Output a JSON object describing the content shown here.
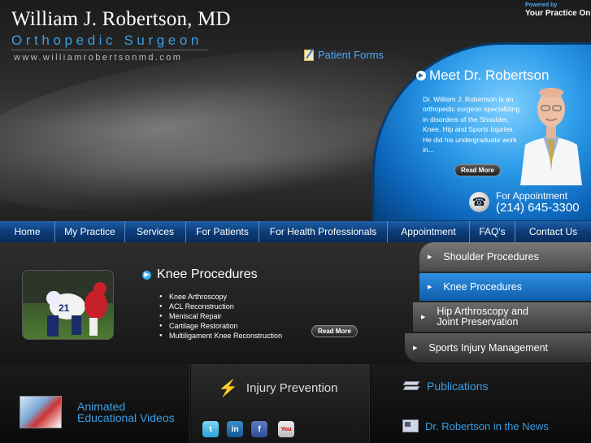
{
  "header": {
    "name": "William J. Robertson, MD",
    "title": "Orthopedic Surgeon",
    "url": "www.williamrobertsonmd.com",
    "powered_by": "Powered by",
    "powered_brand": "Your Practice Online",
    "patient_forms": "Patient Forms"
  },
  "meet": {
    "title": "Meet Dr. Robertson",
    "text": "Dr. William J. Robertson is an orthopedic surgeon specializing in disorders of the Shoulder, Knee, Hip and Sports Injuries. He did his undergraduate work in...",
    "read_more": "Read More",
    "appt_label": "For Appointment",
    "appt_phone": "(214) 645-3300"
  },
  "nav": {
    "items": [
      {
        "label": "Home"
      },
      {
        "label": "My Practice"
      },
      {
        "label": "Services"
      },
      {
        "label": "For Patients"
      },
      {
        "label": "For Health Professionals"
      },
      {
        "label": "Appointment"
      },
      {
        "label": "FAQ's"
      },
      {
        "label": "Contact Us"
      }
    ]
  },
  "knee": {
    "heading": "Knee Procedures",
    "items": [
      "Knee Arthroscopy",
      "ACL Reconstruction",
      "Meniscal Repair",
      "Cartilage Restoration",
      "Multiligament Knee Reconstruction"
    ],
    "read_more": "Read More"
  },
  "procedures": {
    "items": [
      {
        "label": "Shoulder Procedures"
      },
      {
        "label": "Knee Procedures"
      },
      {
        "label": "Hip Arthroscopy and"
      },
      {
        "label": "Joint Preservation"
      },
      {
        "label": "Sports Injury Management"
      }
    ]
  },
  "bottom": {
    "animated_line1": "Animated",
    "animated_line2": "Educational Videos",
    "injury_prevention": "Injury Prevention",
    "publications": "Publications",
    "in_the_news": "Dr. Robertson in the News"
  },
  "icons": [
    "pencil-paper-icon",
    "circle-arrow-icon",
    "phone-icon",
    "twitter-icon",
    "linkedin-icon",
    "facebook-icon",
    "youtube-icon",
    "books-icon",
    "newspaper-icon",
    "runner-icon"
  ],
  "colors": {
    "accent_blue": "#3a9ee6",
    "nav_blue": "#0c3d7a"
  }
}
